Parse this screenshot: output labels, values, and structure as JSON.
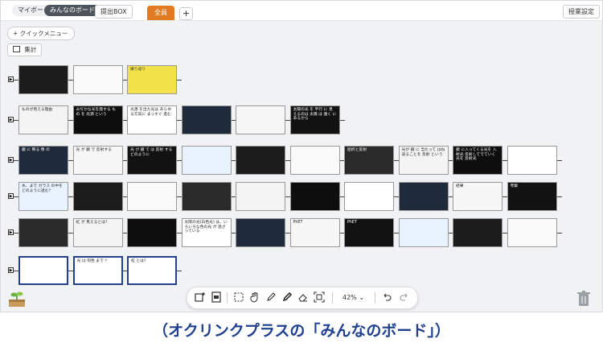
{
  "topbar": {
    "my_board": "マイボード",
    "everyone_board": "みんなのボード",
    "submit_box": "提出BOX",
    "tab_all": "全員",
    "tab_add": "+",
    "class_settings": "授業設定"
  },
  "toolbar_left": {
    "quick_menu": "+ クイックメニュー",
    "tally": "集計"
  },
  "cards": [
    {
      "text": ""
    },
    {
      "text": ""
    },
    {
      "text": "振り返り"
    },
    {
      "text": "ものが見える理由"
    },
    {
      "text": "みぢかな光を発する もの を 光源 という"
    },
    {
      "text": "光源 を出た光は あらゆる方向に まっすぐ 進む"
    },
    {
      "text": ""
    },
    {
      "text": ""
    },
    {
      "text": "太陽の光 を 平行 に 見えるのは 太陽 は 遠く にあるから"
    },
    {
      "text": "鏡 に 映る 像 の"
    },
    {
      "text": "光 が 鏡 で 反射する"
    },
    {
      "text": "光 が 鏡 で は 反射 する どのように"
    },
    {
      "text": ""
    },
    {
      "text": ""
    },
    {
      "text": ""
    },
    {
      "text": "屈折と反射"
    },
    {
      "text": "光が 鏡 に 当たって はね返ることを 反射 という"
    },
    {
      "text": "鏡 に入ってくる光を 入射光 反射してでていく光を 反射光"
    },
    {
      "text": ""
    },
    {
      "text": "水、まで ガラス の中を どのように進む？"
    },
    {
      "text": ""
    },
    {
      "text": ""
    },
    {
      "text": ""
    },
    {
      "text": ""
    },
    {
      "text": ""
    },
    {
      "text": ""
    },
    {
      "text": ""
    },
    {
      "text": "結果"
    },
    {
      "text": "考察"
    },
    {
      "text": ""
    },
    {
      "text": "虹 が 見えるとは？"
    },
    {
      "text": ""
    },
    {
      "text": "太陽の光(白色光) は、いろいろな色の光 が 混ざっている"
    },
    {
      "text": ""
    },
    {
      "text": "PhET"
    },
    {
      "text": "PhET"
    },
    {
      "text": ""
    },
    {
      "text": ""
    },
    {
      "text": ""
    },
    {
      "text": ""
    },
    {
      "text": "光 は 何色 まで ？"
    },
    {
      "text": "虹 とは？"
    },
    {
      "text": ""
    },
    {
      "text": ""
    },
    {
      "text": ""
    }
  ],
  "bottom_toolbar": {
    "zoom": "42%",
    "zoom_caret": "⌄"
  },
  "caption": "（オクリンクプラスの「みんなのボード」）",
  "colors": {
    "accent_orange": "#e07b22",
    "caption_blue": "#1f3f8f"
  }
}
